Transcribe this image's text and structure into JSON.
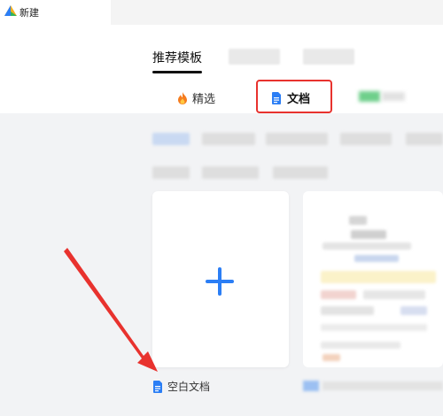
{
  "titlebar": {
    "title": "新建"
  },
  "tabs": {
    "recommend": "推荐模板"
  },
  "categories": {
    "featured": "精选",
    "doc": "文档"
  },
  "blank_doc": {
    "label": "空白文档"
  },
  "icons": {
    "app_logo": "app-logo-icon",
    "fire": "fire-icon",
    "doc": "doc-icon",
    "plus": "plus-icon"
  },
  "colors": {
    "accent": "#2b7ef5",
    "highlight": "#e8322e",
    "fire": "#f57c1f",
    "panel_bg": "#f2f3f5"
  }
}
